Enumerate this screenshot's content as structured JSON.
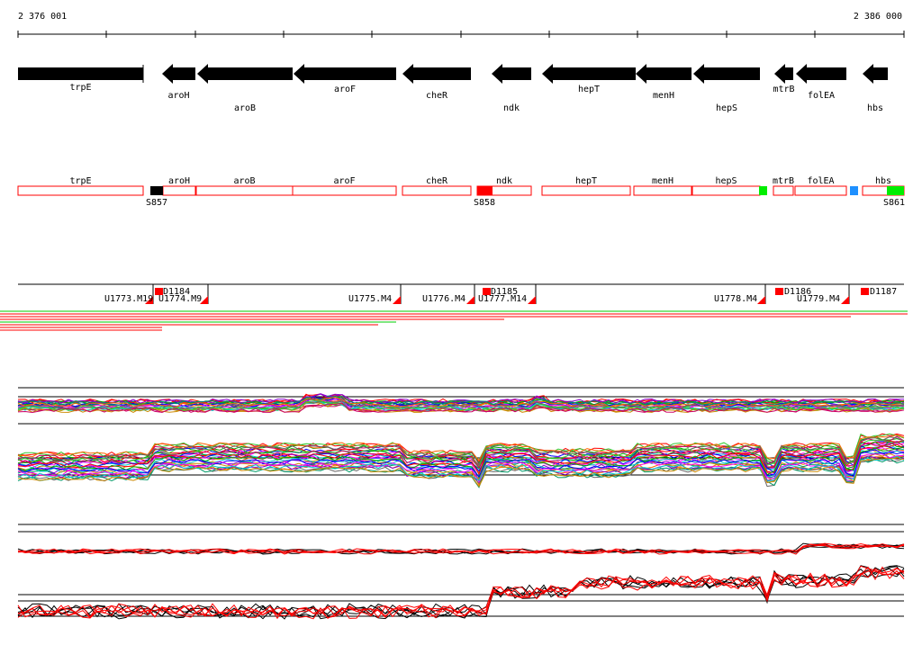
{
  "ruler": {
    "start_label": "2 376 001",
    "end_label": "2 386 000"
  },
  "genes": [
    {
      "name": "trpE",
      "dir": "+"
    },
    {
      "name": "aroH",
      "dir": "-"
    },
    {
      "name": "aroB",
      "dir": "-"
    },
    {
      "name": "aroF",
      "dir": "-"
    },
    {
      "name": "cheR",
      "dir": "-"
    },
    {
      "name": "ndk",
      "dir": "-"
    },
    {
      "name": "hepT",
      "dir": "-"
    },
    {
      "name": "menH",
      "dir": "-"
    },
    {
      "name": "hepS",
      "dir": "-"
    },
    {
      "name": "mtrB",
      "dir": "-"
    },
    {
      "name": "folEA",
      "dir": "-"
    },
    {
      "name": "hbs",
      "dir": "-"
    }
  ],
  "boxes": [
    {
      "name": "trpE"
    },
    {
      "name": "aroH"
    },
    {
      "name": "aroB"
    },
    {
      "name": "aroF"
    },
    {
      "name": "cheR"
    },
    {
      "name": "ndk"
    },
    {
      "name": "hepT"
    },
    {
      "name": "menH"
    },
    {
      "name": "hepS"
    },
    {
      "name": "mtrB"
    },
    {
      "name": "folEA"
    },
    {
      "name": "hbs"
    }
  ],
  "sites": [
    {
      "label": "S857",
      "color": "#000000"
    },
    {
      "label": "S858",
      "color": "#ff0000"
    },
    {
      "label": "",
      "color": "#00ee00"
    },
    {
      "label": "",
      "color": "#1e90ff"
    },
    {
      "label": "S861",
      "color": "#00ee00"
    }
  ],
  "features": [
    {
      "label": "D1184",
      "kind": "D"
    },
    {
      "label": "U1773.M19",
      "kind": "U"
    },
    {
      "label": "U1774.M9",
      "kind": "U"
    },
    {
      "label": "U1775.M4",
      "kind": "U"
    },
    {
      "label": "U1776.M4",
      "kind": "U"
    },
    {
      "label": "D1185",
      "kind": "D"
    },
    {
      "label": "U1777.M14",
      "kind": "U"
    },
    {
      "label": "U1778.M4",
      "kind": "U"
    },
    {
      "label": "D1186",
      "kind": "D"
    },
    {
      "label": "U1779.M4",
      "kind": "U"
    },
    {
      "label": "D1187",
      "kind": "D"
    }
  ],
  "colors": {
    "gene": "#000000",
    "box_outline": "#ff0000",
    "feature_mark": "#ff0000",
    "track_a": "#ff0000",
    "track_b": "#00cc00"
  }
}
